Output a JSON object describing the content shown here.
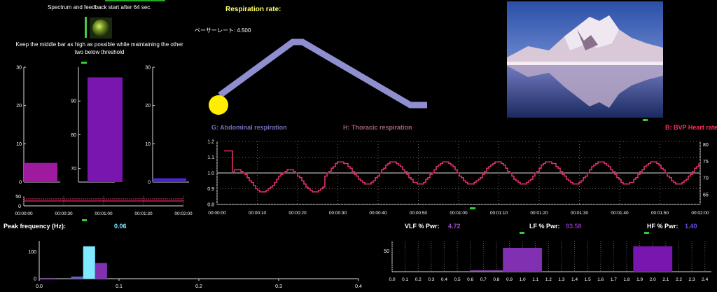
{
  "header": {
    "instruction_top": "Spectrum and feedback start after 64 sec.",
    "instruction_bars": "Keep the middle bar as high as possible while maintaining the other two below threshold",
    "resp_title": "Respiration rate:",
    "resp_value": "ベーサーレート: 4.500"
  },
  "respiration_legend": {
    "abdominal": "G: Abdominal respiration",
    "thoracic": "H: Thoracic respiration",
    "bvp": "B: BVP Heart rate"
  },
  "bar_panels": {
    "left": {
      "ticks": [
        "30",
        "20",
        "10",
        "0"
      ],
      "value": 5,
      "max": 30,
      "color": "#a01aa0"
    },
    "middle": {
      "ticks": [
        "90",
        "80",
        "70"
      ],
      "value": 97,
      "min": 66,
      "max": 100,
      "color": "#7a16b0"
    },
    "right": {
      "ticks": [
        "30",
        "20",
        "10",
        "0"
      ],
      "value": 1,
      "max": 30,
      "color": "#4a26c8"
    }
  },
  "mini_trend": {
    "y_ticks": [
      "50",
      "0"
    ],
    "x_ticks": [
      "00:00:00",
      "00:00:30",
      "00:01:00",
      "00:01:30",
      "00:02:00"
    ]
  },
  "main_chart": {
    "left_ticks": [
      "1.2",
      "1.1",
      "1.0",
      "0.9",
      "0.8"
    ],
    "right_ticks": [
      "80",
      "75",
      "70",
      "65"
    ],
    "x_ticks": [
      "00:00:00",
      "00:00:10",
      "00:00:20",
      "00:00:30",
      "00:00:40",
      "00:00:50",
      "00:01:00",
      "00:01:10",
      "00:01:20",
      "00:01:30",
      "00:01:40",
      "00:01:50",
      "00:02:00"
    ]
  },
  "stats": {
    "peak_label": "Peak frequency (Hz):",
    "peak_value": "0.06",
    "vlf_label": "VLF % Pwr:",
    "vlf_value": "4.72",
    "lf_label": "LF % Pwr:",
    "lf_value": "93.58",
    "hf_label": "HF % Pwr:",
    "hf_value": "1.40"
  },
  "spectrum_left": {
    "y_ticks": [
      "100",
      "0"
    ],
    "x_ticks": [
      "0.0",
      "0.1",
      "0.2",
      "0.3",
      "0.4"
    ]
  },
  "spectrum_right": {
    "y_ticks": [
      "50"
    ],
    "x_ticks": [
      "0.0",
      "0.1",
      "0.2",
      "0.3",
      "0.4",
      "0.5",
      "0.6",
      "0.7",
      "0.8",
      "0.9",
      "1.0",
      "1.1",
      "1.2",
      "1.3",
      "1.4",
      "1.5",
      "1.6",
      "1.7",
      "1.8",
      "1.9",
      "2.0",
      "2.1",
      "2.2",
      "2.3",
      "2.4"
    ]
  },
  "colors": {
    "resp_line": "#8f8fd0",
    "ball": "#ffee00",
    "bvp_line": "#e0306a",
    "abdominal": "#7070b8",
    "thoracic": "#a06078",
    "bvp_label": "#ff3060",
    "vlf": "#a050d0",
    "lf": "#8030b0",
    "hf": "#6050e0",
    "cyan": "#80e8ff"
  },
  "icons": {
    "feedback_orb": "green-orb-icon",
    "scenery_image": "mountain-lake-image"
  }
}
